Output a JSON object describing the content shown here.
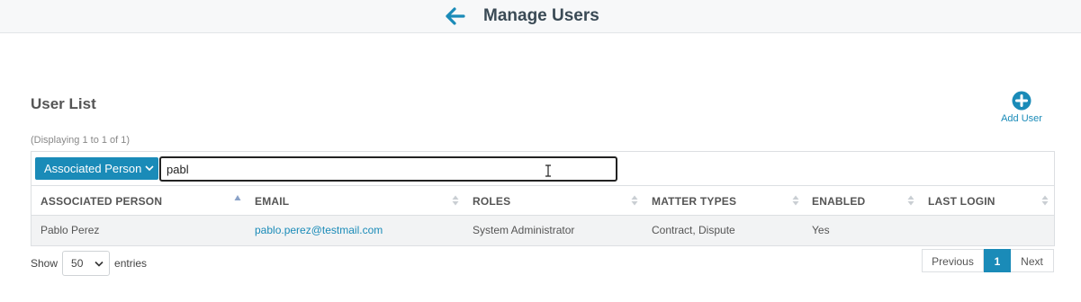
{
  "header": {
    "title": "Manage Users",
    "back_icon": "arrow-left-icon"
  },
  "user_list": {
    "title": "User List",
    "add_user_label": "Add User",
    "add_user_icon": "plus-circle-icon",
    "displaying": "(Displaying 1 to 1 of 1)",
    "filter": {
      "field": "Associated Person",
      "value": "pabl"
    },
    "columns": [
      "ASSOCIATED PERSON",
      "EMAIL",
      "ROLES",
      "MATTER TYPES",
      "ENABLED",
      "LAST LOGIN"
    ],
    "rows": [
      {
        "associated_person": "Pablo Perez",
        "email": "pablo.perez@testmail.com",
        "roles": "System Administrator",
        "matter_types": "Contract, Dispute",
        "enabled": "Yes",
        "last_login": ""
      }
    ]
  },
  "footer": {
    "show_label": "Show",
    "entries_value": "50",
    "entries_label": "entries",
    "pagination": {
      "previous": "Previous",
      "current": "1",
      "next": "Next"
    }
  },
  "colors": {
    "accent": "#1a8bb8",
    "header_bg": "#f7f8f9",
    "row_bg": "#f2f3f4"
  }
}
